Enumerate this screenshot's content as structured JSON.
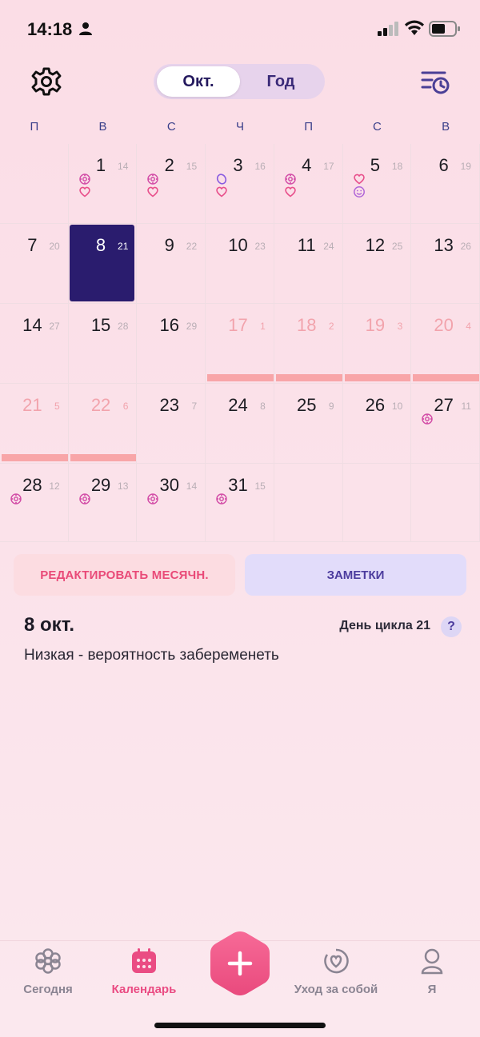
{
  "status": {
    "time": "14:18"
  },
  "header": {
    "toggle_month": "Окт.",
    "toggle_year": "Год"
  },
  "weekdays": [
    "П",
    "В",
    "С",
    "Ч",
    "П",
    "С",
    "В"
  ],
  "calendar": {
    "days": [
      {
        "d": "1",
        "c": "14",
        "icons": [
          "flower-icon",
          "heart-icon"
        ]
      },
      {
        "d": "2",
        "c": "15",
        "icons": [
          "flower-icon",
          "heart-icon"
        ]
      },
      {
        "d": "3",
        "c": "16",
        "icons": [
          "egg-icon",
          "heart-icon"
        ]
      },
      {
        "d": "4",
        "c": "17",
        "icons": [
          "flower-icon",
          "heart-icon"
        ]
      },
      {
        "d": "5",
        "c": "18",
        "icons": [
          "heart-icon",
          "smile-icon"
        ]
      },
      {
        "d": "6",
        "c": "19",
        "icons": []
      },
      {
        "d": "7",
        "c": "20",
        "icons": []
      },
      {
        "d": "8",
        "c": "21",
        "icons": [],
        "selected": true
      },
      {
        "d": "9",
        "c": "22",
        "icons": []
      },
      {
        "d": "10",
        "c": "23",
        "icons": []
      },
      {
        "d": "11",
        "c": "24",
        "icons": []
      },
      {
        "d": "12",
        "c": "25",
        "icons": []
      },
      {
        "d": "13",
        "c": "26",
        "icons": []
      },
      {
        "d": "14",
        "c": "27",
        "icons": []
      },
      {
        "d": "15",
        "c": "28",
        "icons": []
      },
      {
        "d": "16",
        "c": "29",
        "icons": []
      },
      {
        "d": "17",
        "c": "1",
        "icons": [],
        "predicted": true
      },
      {
        "d": "18",
        "c": "2",
        "icons": [],
        "predicted": true
      },
      {
        "d": "19",
        "c": "3",
        "icons": [],
        "predicted": true
      },
      {
        "d": "20",
        "c": "4",
        "icons": [],
        "predicted": true
      },
      {
        "d": "21",
        "c": "5",
        "icons": [],
        "predicted": true
      },
      {
        "d": "22",
        "c": "6",
        "icons": [],
        "predicted": true
      },
      {
        "d": "23",
        "c": "7",
        "icons": []
      },
      {
        "d": "24",
        "c": "8",
        "icons": []
      },
      {
        "d": "25",
        "c": "9",
        "icons": []
      },
      {
        "d": "26",
        "c": "10",
        "icons": []
      },
      {
        "d": "27",
        "c": "11",
        "icons": [
          "flower-icon"
        ]
      },
      {
        "d": "28",
        "c": "12",
        "icons": [
          "flower-icon"
        ]
      },
      {
        "d": "29",
        "c": "13",
        "icons": [
          "flower-icon"
        ]
      },
      {
        "d": "30",
        "c": "14",
        "icons": [
          "flower-icon"
        ]
      },
      {
        "d": "31",
        "c": "15",
        "icons": [
          "flower-icon"
        ]
      }
    ]
  },
  "actions": {
    "edit_period": "РЕДАКТИРОВАТЬ МЕСЯЧН.",
    "notes": "ЗАМЕТКИ"
  },
  "details": {
    "date": "8 окт.",
    "cycle_day": "День цикла 21",
    "help": "?",
    "fertility": "Низкая - вероятность забеременеть"
  },
  "nav": {
    "today": "Сегодня",
    "calendar": "Календарь",
    "self_care": "Уход за собой",
    "me": "Я"
  },
  "colors": {
    "accent_pink": "#ea4c83",
    "selected_day": "#2a1c6e",
    "period_bar": "#f8a5a8",
    "predicted_text": "#f2a3ac"
  }
}
